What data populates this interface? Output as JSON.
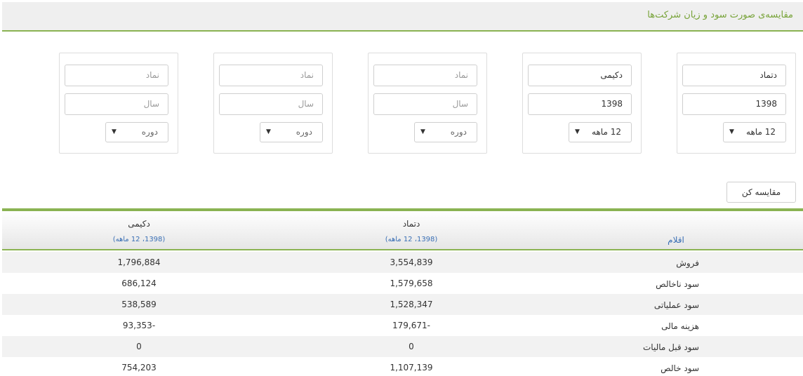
{
  "header": {
    "title": "مقایسه‌ی صورت سود و زیان شرکت‌ها"
  },
  "cards": [
    {
      "symbol": "دتماد",
      "symbol_is_placeholder": false,
      "year": "1398",
      "year_is_placeholder": false,
      "period": "12 ماهه",
      "period_is_placeholder": false
    },
    {
      "symbol": "دکیمی",
      "symbol_is_placeholder": false,
      "year": "1398",
      "year_is_placeholder": false,
      "period": "12 ماهه",
      "period_is_placeholder": false
    },
    {
      "symbol": "نماد",
      "symbol_is_placeholder": true,
      "year": "سال",
      "year_is_placeholder": true,
      "period": "دوره",
      "period_is_placeholder": true
    },
    {
      "symbol": "نماد",
      "symbol_is_placeholder": true,
      "year": "سال",
      "year_is_placeholder": true,
      "period": "دوره",
      "period_is_placeholder": true
    },
    {
      "symbol": "نماد",
      "symbol_is_placeholder": true,
      "year": "سال",
      "year_is_placeholder": true,
      "period": "دوره",
      "period_is_placeholder": true
    }
  ],
  "dropdown_arrow": "▼",
  "compare_button": "مقایسه کن",
  "table": {
    "items_header": "اقلام",
    "columns": [
      {
        "name": "دتماد",
        "sub": "(1398، 12 ماهه)"
      },
      {
        "name": "دکیمی",
        "sub": "(1398، 12 ماهه)"
      }
    ],
    "rows": [
      {
        "label": "فروش",
        "values": [
          "3,554,839",
          "1,796,884"
        ]
      },
      {
        "label": "سود ناخالص",
        "values": [
          "1,579,658",
          "686,124"
        ]
      },
      {
        "label": "سود عملیاتی",
        "values": [
          "1,528,347",
          "538,589"
        ]
      },
      {
        "label": "هزینه مالی",
        "values": [
          "179,671-",
          "93,353-"
        ]
      },
      {
        "label": "سود قبل مالیات",
        "values": [
          "0",
          "0"
        ]
      },
      {
        "label": "سود خالص",
        "values": [
          "1,107,139",
          "754,203"
        ]
      }
    ]
  },
  "colors": {
    "accent_green": "#8ab352",
    "title_green": "#77a338",
    "link_blue": "#3a6fb5"
  }
}
